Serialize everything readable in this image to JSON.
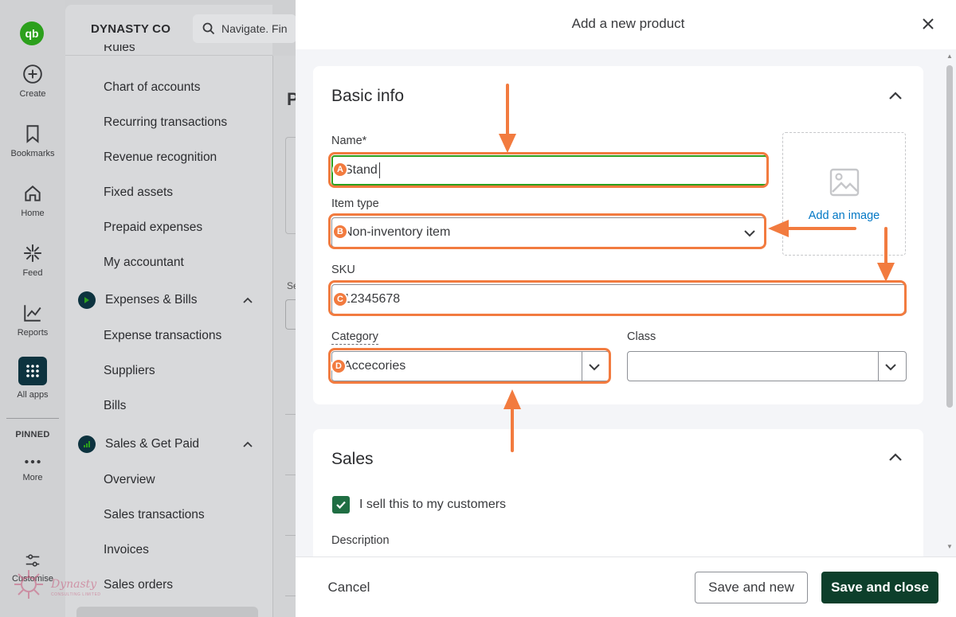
{
  "rail": {
    "logo": "qb",
    "items": [
      {
        "label": "Create",
        "icon": "plus-circle-icon"
      },
      {
        "label": "Bookmarks",
        "icon": "bookmark-icon"
      },
      {
        "label": "Home",
        "icon": "home-icon"
      },
      {
        "label": "Feed",
        "icon": "feed-icon"
      },
      {
        "label": "Reports",
        "icon": "reports-icon"
      },
      {
        "label": "All apps",
        "icon": "grid-icon"
      }
    ],
    "pinned": "PINNED",
    "more": "More",
    "customise": "Customise"
  },
  "header": {
    "company": "DYNASTY CO",
    "search_placeholder": "Navigate. Fin"
  },
  "nav": {
    "truncated_top": "Rules",
    "items_a": [
      "Chart of accounts",
      "Recurring transactions",
      "Revenue recognition",
      "Fixed assets",
      "Prepaid expenses",
      "My accountant"
    ],
    "group_expenses": "Expenses & Bills",
    "items_b": [
      "Expense transactions",
      "Suppliers",
      "Bills"
    ],
    "group_sales": "Sales & Get Paid",
    "items_c": [
      "Overview",
      "Sales transactions",
      "Invoices",
      "Sales orders"
    ]
  },
  "background": {
    "heading_letter": "P",
    "label_letter": "Se"
  },
  "drawer": {
    "title": "Add a new product",
    "basic_info": {
      "title": "Basic info",
      "name_label": "Name*",
      "name_value": "Stand",
      "item_type_label": "Item type",
      "item_type_value": "Non-inventory item",
      "sku_label": "SKU",
      "sku_value": "12345678",
      "category_label": "Category",
      "category_value": "Accecories",
      "class_label": "Class",
      "class_value": "",
      "add_image": "Add an image"
    },
    "sales": {
      "title": "Sales",
      "sell_checkbox_label": "I sell this to my customers",
      "sell_checked": true,
      "description_label": "Description"
    },
    "footer": {
      "cancel": "Cancel",
      "save_and_new": "Save and new",
      "save_and_close": "Save and close"
    }
  },
  "annotations": {
    "markers": [
      "A",
      "B",
      "C",
      "D"
    ],
    "color": "#f27b3f"
  },
  "watermark": {
    "text": "Dynasty",
    "subtext": "CONSULTING LIMITED"
  },
  "colors": {
    "brand_green": "#2ca01c",
    "dark_button": "#0d3f2b",
    "link_blue": "#0077c5"
  }
}
